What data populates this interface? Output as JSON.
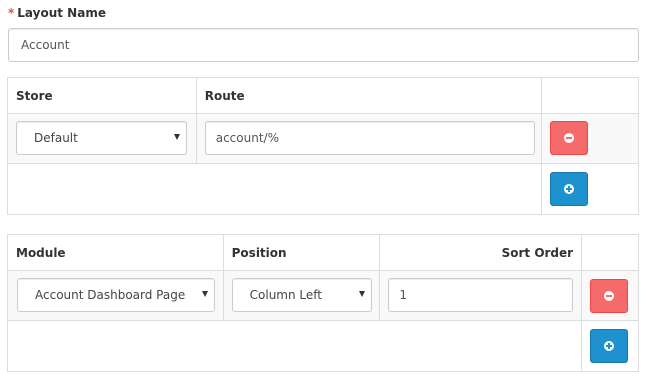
{
  "layout_name": {
    "required_mark": "*",
    "label": "Layout Name",
    "value": "Account"
  },
  "routes_table": {
    "headers": {
      "store": "Store",
      "route": "Route"
    },
    "rows": [
      {
        "store": "Default",
        "route": "account/%"
      }
    ]
  },
  "modules_table": {
    "headers": {
      "module": "Module",
      "position": "Position",
      "sort_order": "Sort Order"
    },
    "rows": [
      {
        "module": "Account Dashboard Page",
        "position": "Column Left",
        "sort_order": "1"
      }
    ]
  },
  "colors": {
    "danger": "#f56b6b",
    "primary": "#1e91cf",
    "required": "#d9534f"
  },
  "icons": {
    "remove": "minus-circle-icon",
    "add": "plus-circle-icon",
    "dropdown": "caret-down-icon"
  }
}
